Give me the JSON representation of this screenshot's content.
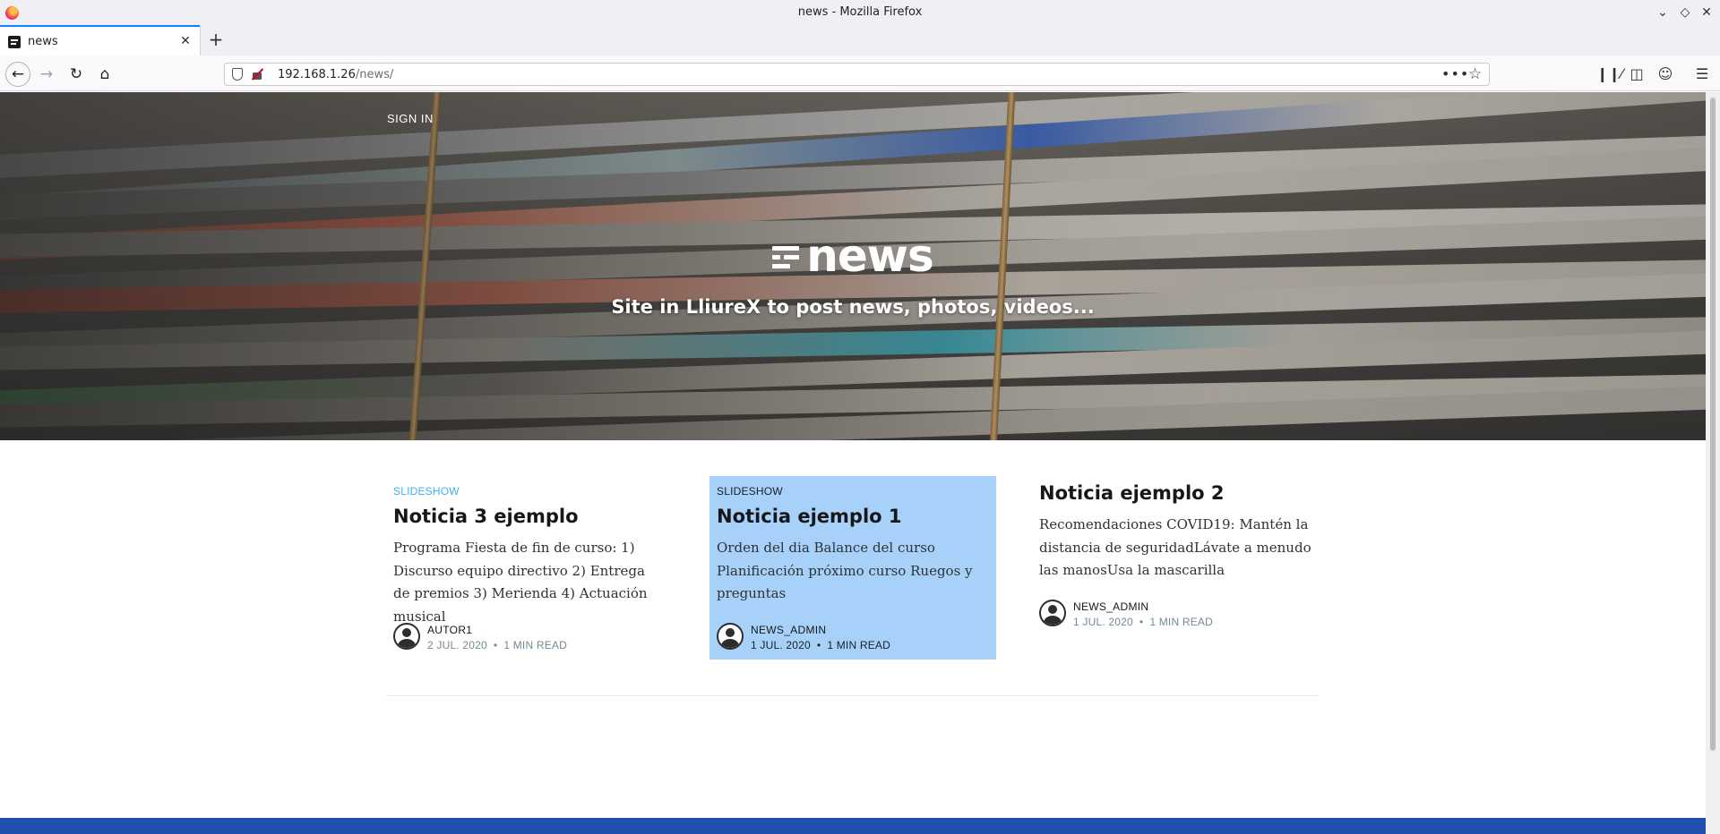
{
  "window": {
    "title": "news - Mozilla Firefox"
  },
  "tabs": [
    {
      "label": "news"
    }
  ],
  "navbar": {
    "url_host": "192.168.1.26",
    "url_path": "/news/"
  },
  "site": {
    "signin_label": "SIGN IN",
    "brand_name": "news",
    "description": "Site in LliureX to post news, photos, videos..."
  },
  "posts": [
    {
      "tag": "SLIDESHOW",
      "title": "Noticia 3 ejemplo",
      "excerpt": "Programa Fiesta de fin de curso: 1) Discurso equipo directivo 2) Entrega de premios 3) Merienda 4) Actuación musical",
      "author": "AUTOR1",
      "date": "2 JUL. 2020",
      "read_time": "1 MIN READ",
      "highlighted": false
    },
    {
      "tag": "SLIDESHOW",
      "title": "Noticia ejemplo 1",
      "excerpt": "Orden del dia Balance del curso Planificación próximo curso Ruegos y preguntas",
      "author": "NEWS_ADMIN",
      "date": "1 JUL. 2020",
      "read_time": "1 MIN READ",
      "highlighted": true
    },
    {
      "tag": "",
      "title": "Noticia ejemplo 2",
      "excerpt": "Recomendaciones COVID19: Mantén la distancia de seguridadLávate a menudo las manosUsa la mascarilla",
      "author": "NEWS_ADMIN",
      "date": "1 JUL. 2020",
      "read_time": "1 MIN READ",
      "highlighted": false
    }
  ],
  "colors": {
    "accent_tag": "#3eb0ef",
    "highlight_card": "#a8d1f9",
    "footer": "#1f4fb0"
  }
}
